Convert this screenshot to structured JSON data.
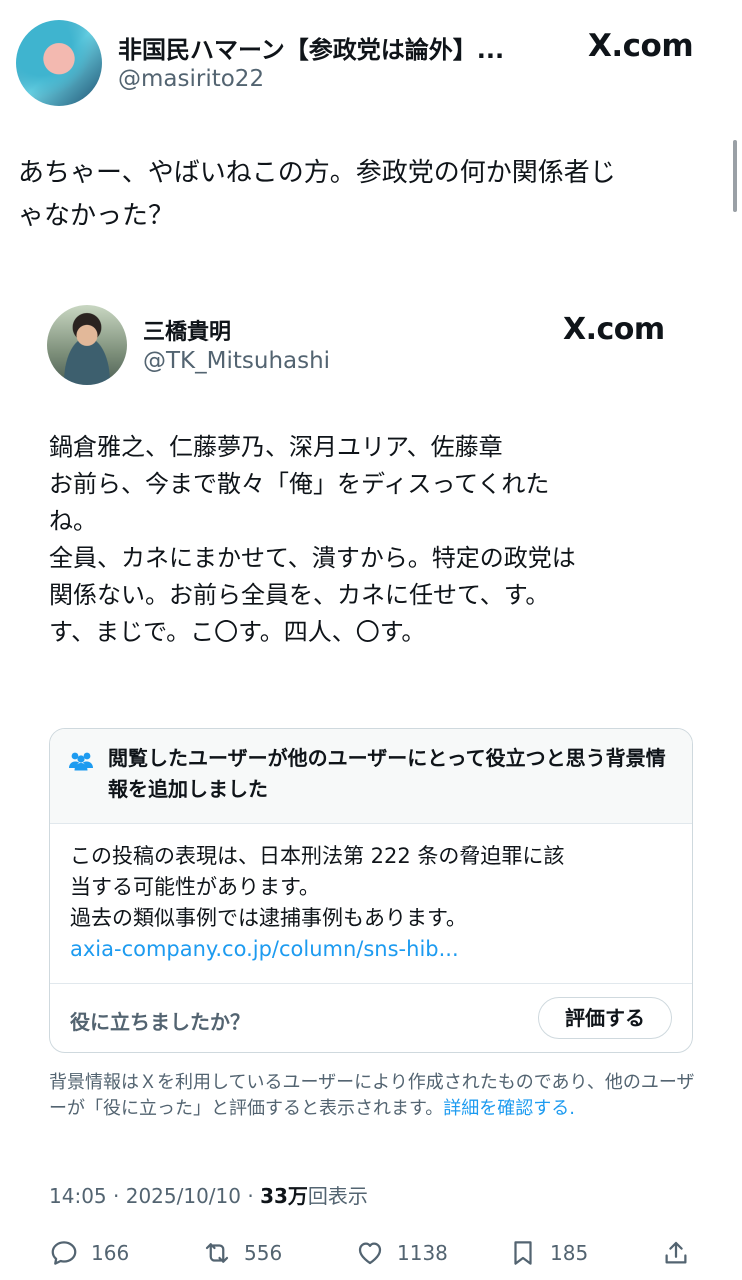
{
  "tweet": {
    "author_name": "非国民ハマーン【参政党は論外】...",
    "author_handle": "@masirito22",
    "source": "X.com",
    "text_lines": [
      "あちゃー、やばいねこの方。参政党の何か関係者じ",
      "ゃなかった？"
    ]
  },
  "quoted": {
    "author_name": "三橋貴明",
    "author_handle": "@TK_Mitsuhashi",
    "source": "X.com",
    "text_lines": [
      "鍋倉雅之、仁藤夢乃、深月ユリア、佐藤章",
      "お前ら、今まで散々「俺」をディスってくれた",
      "ね。",
      "全員、カネにまかせて、潰すから。特定の政党は",
      "関係ない。お前ら全員を、カネに任せて、す。",
      "す、まじで。こ〇す。四人、〇す。"
    ]
  },
  "community_note": {
    "title": "閲覧したユーザーが他のユーザーにとって役立つと思う背景情報を追加しました",
    "body_lines": [
      "この投稿の表現は、日本刑法第 222 条の脅迫罪に該",
      "当する可能性があります。",
      "過去の類似事例では逮捕事例もあります。"
    ],
    "link": "axia-company.co.jp/column/sns-hib...",
    "helpful_question": "役に立ちましたか？",
    "rate_button": "評価する"
  },
  "disclaimer": {
    "text": "背景情報はＸを利用しているユーザーにより作成されたものであり、他のユーザーが「役に立った」と評価すると表示されます。",
    "more_link": "詳細を確認する."
  },
  "meta": {
    "time": "14:05",
    "date": "2025/10/10",
    "views_count": "33万",
    "views_label": "回表示"
  },
  "actions": {
    "replies": "166",
    "reposts": "556",
    "likes": "1138",
    "bookmarks": "185"
  },
  "colors": {
    "link": "#1d9bf0",
    "secondary_text": "#536471",
    "border": "#cfd9de"
  }
}
